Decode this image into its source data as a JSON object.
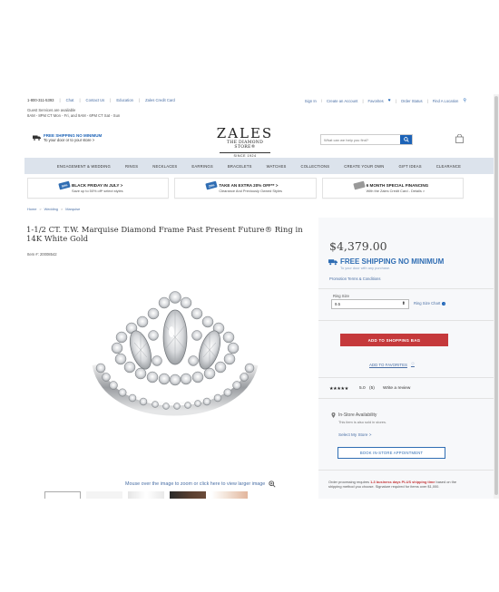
{
  "utility": {
    "phone": "1-800-311-5393",
    "links": [
      "Chat",
      "Contact Us",
      "Education",
      "Zales Credit Card"
    ],
    "guest_line1": "Guest Services are available",
    "guest_line2": "8AM - 8PM CT Mon - Fri, and 9AM - 6PM CT Sat - Sun",
    "signin": "Sign In",
    "slash": "/",
    "create_account": "Create an Account",
    "favorites": "Favorites",
    "order_status": "Order Status",
    "find_location": "Find A Location"
  },
  "header": {
    "free_shipping": "FREE SHIPPING NO MINIMUM",
    "free_shipping_sub": "To your door or to your store >",
    "logo_name": "ZALES",
    "logo_sub": "THE DIAMOND STORE®",
    "logo_since": "SINCE 1924",
    "search_placeholder": "What can we help you find?"
  },
  "nav": [
    "ENGAGEMENT & WEDDING",
    "RINGS",
    "NECKLACES",
    "EARRINGS",
    "BRACELETS",
    "WATCHES",
    "COLLECTIONS",
    "CREATE YOUR OWN",
    "GIFT IDEAS",
    "CLEARANCE"
  ],
  "promos": [
    {
      "tag": "50%",
      "headline": "BLACK FRIDAY IN JULY >",
      "sub": "Save up to 50% off* select styles"
    },
    {
      "tag": "20%",
      "headline": "TAKE AN EXTRA 20% OFF** >",
      "sub": "Clearance And Previously Owned Styles"
    },
    {
      "tag": "",
      "headline": "6 MONTH SPECIAL FINANCING",
      "sub": "With the Zales Credit Card - Details >"
    }
  ],
  "breadcrumb": [
    "Home",
    "Wedding",
    "Marquise"
  ],
  "product": {
    "title": "1-1/2 CT. T.W. Marquise Diamond Frame Past Present Future® Ring in 14K White Gold",
    "item_number": "Item #: 20008542",
    "zoom_hint": "Mouse over the image to zoom or click here to view larger image"
  },
  "purchase": {
    "price": "$4,379.00",
    "ship_headline": "FREE SHIPPING NO MINIMUM",
    "ship_sub": "To your door with any purchase.",
    "promo_terms": "Promotion Terms & Conditions",
    "ring_size_label": "Ring Size",
    "ring_size_value": "9.5",
    "ring_size_chart": "Ring Size Chart",
    "add_to_bag": "ADD TO SHOPPING BAG",
    "add_to_favorites": "ADD TO FAVORITES",
    "rating_stars": "★★★★★",
    "rating_value": "5.0",
    "rating_count": "(5)",
    "write_review": "Write a review",
    "in_store": "In-Store Availability",
    "in_store_sub": "This item is also sold in stores.",
    "select_store": "Select My Store >",
    "book_appointment": "BOOK IN-STORE APPOINTMENT",
    "order_note_pre": "Order processing requires",
    "order_note_red": "1-3 business days PLUS shipping time",
    "order_note_post": "based on the shipping method you choose. Signature required for items over $1,000."
  },
  "colors": {
    "accent_blue": "#1c63b7",
    "cta_red": "#c5393b",
    "nav_bg": "#dce3ec"
  }
}
